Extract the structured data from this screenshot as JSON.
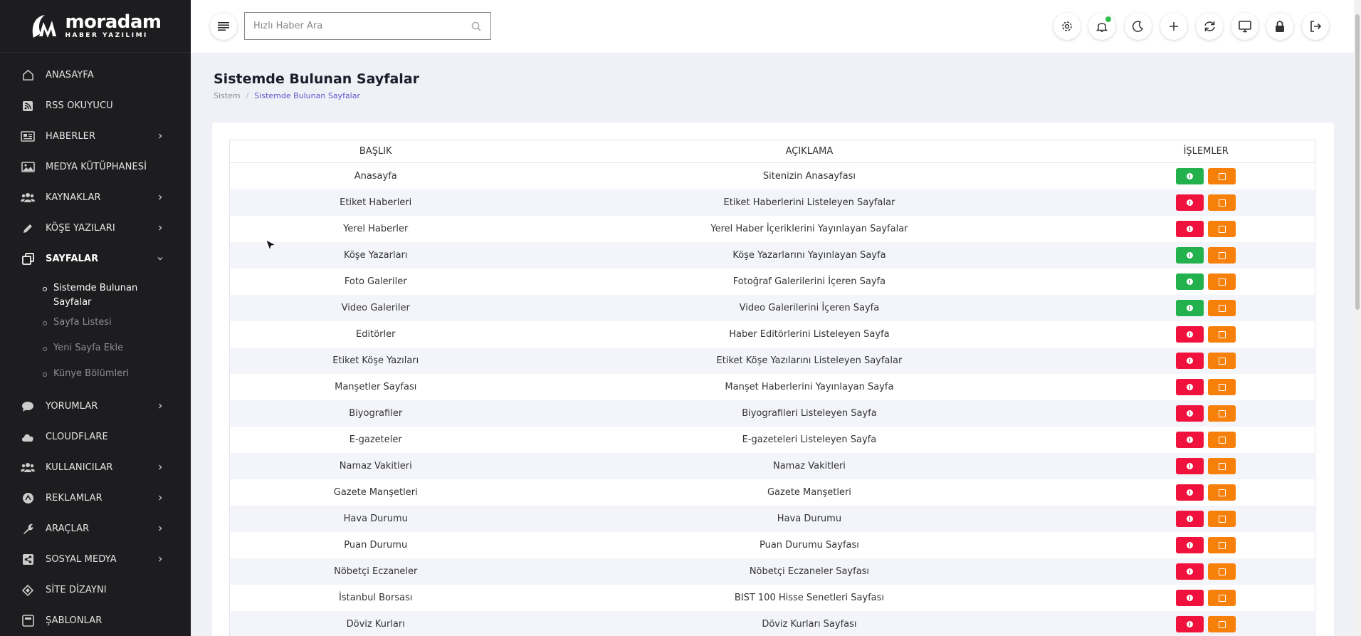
{
  "brand": {
    "name": "moradam",
    "tagline": "HABER YAZILIMI"
  },
  "sidebar": {
    "items": [
      {
        "label": "ANASAYFA",
        "icon": "home-icon",
        "chevron": false
      },
      {
        "label": "RSS OKUYUCU",
        "icon": "rss-icon",
        "chevron": false
      },
      {
        "label": "HABERLER",
        "icon": "newspaper-icon",
        "chevron": true
      },
      {
        "label": "MEDYA KÜTÜPHANESİ",
        "icon": "image-icon",
        "chevron": false
      },
      {
        "label": "KAYNAKLAR",
        "icon": "users-icon",
        "chevron": true
      },
      {
        "label": "KÖŞE YAZILARI",
        "icon": "pencil-icon",
        "chevron": true
      },
      {
        "label": "SAYFALAR",
        "icon": "pages-icon",
        "chevron": "down"
      },
      {
        "label": "YORUMLAR",
        "icon": "comment-icon",
        "chevron": true
      },
      {
        "label": "CLOUDFLARE",
        "icon": "cloud-icon",
        "chevron": false
      },
      {
        "label": "KULLANICILAR",
        "icon": "users-icon",
        "chevron": true
      },
      {
        "label": "REKLAMLAR",
        "icon": "ads-icon",
        "chevron": true
      },
      {
        "label": "ARAÇLAR",
        "icon": "wrench-icon",
        "chevron": true
      },
      {
        "label": "SOSYAL MEDYA",
        "icon": "share-icon",
        "chevron": true
      },
      {
        "label": "SİTE DİZAYNI",
        "icon": "design-icon",
        "chevron": false
      },
      {
        "label": "ŞABLONLAR",
        "icon": "template-icon",
        "chevron": false
      }
    ],
    "submenu": [
      {
        "label": "Sistemde Bulunan Sayfalar",
        "active": true
      },
      {
        "label": "Sayfa Listesi",
        "active": false
      },
      {
        "label": "Yeni Sayfa Ekle",
        "active": false
      },
      {
        "label": "Künye Bölümleri",
        "active": false
      }
    ]
  },
  "topbar": {
    "search_placeholder": "Hızlı Haber Ara",
    "actions": [
      "settings-icon",
      "bell-icon",
      "moon-icon",
      "plus-icon",
      "refresh-icon",
      "monitor-icon",
      "lock-icon",
      "logout-icon"
    ]
  },
  "page": {
    "title": "Sistemde Bulunan Sayfalar",
    "breadcrumb": [
      "Sistem",
      "Sistemde Bulunan Sayfalar"
    ]
  },
  "table": {
    "headers": [
      "BAŞLIK",
      "AÇIKLAMA",
      "İŞLEMLER"
    ],
    "rows": [
      {
        "title": "Anasayfa",
        "desc": "Sitenizin Anasayfası",
        "status": "green"
      },
      {
        "title": "Etiket Haberleri",
        "desc": "Etiket Haberlerini Listeleyen Sayfalar",
        "status": "red"
      },
      {
        "title": "Yerel Haberler",
        "desc": "Yerel Haber İçeriklerini Yayınlayan Sayfalar",
        "status": "red"
      },
      {
        "title": "Köşe Yazarları",
        "desc": "Köşe Yazarlarını Yayınlayan Sayfa",
        "status": "green"
      },
      {
        "title": "Foto Galeriler",
        "desc": "Fotoğraf Galerilerini İçeren Sayfa",
        "status": "green"
      },
      {
        "title": "Video Galeriler",
        "desc": "Video Galerilerini İçeren Sayfa",
        "status": "green"
      },
      {
        "title": "Editörler",
        "desc": "Haber Editörlerini Listeleyen Sayfa",
        "status": "red"
      },
      {
        "title": "Etiket Köşe Yazıları",
        "desc": "Etiket Köşe Yazılarını Listeleyen Sayfalar",
        "status": "red"
      },
      {
        "title": "Manşetler Sayfası",
        "desc": "Manşet Haberlerini Yayınlayan Sayfa",
        "status": "red"
      },
      {
        "title": "Biyografiler",
        "desc": "Biyografileri Listeleyen Sayfa",
        "status": "red"
      },
      {
        "title": "E-gazeteler",
        "desc": "E-gazeteleri Listeleyen Sayfa",
        "status": "red"
      },
      {
        "title": "Namaz Vakitleri",
        "desc": "Namaz Vakitleri",
        "status": "red"
      },
      {
        "title": "Gazete Manşetleri",
        "desc": "Gazete Manşetleri",
        "status": "red"
      },
      {
        "title": "Hava Durumu",
        "desc": "Hava Durumu",
        "status": "red"
      },
      {
        "title": "Puan Durumu",
        "desc": "Puan Durumu Sayfası",
        "status": "red"
      },
      {
        "title": "Nöbetçi Eczaneler",
        "desc": "Nöbetçi Eczaneler Sayfası",
        "status": "red"
      },
      {
        "title": "İstanbul Borsası",
        "desc": "BIST 100 Hisse Senetleri Sayfası",
        "status": "red"
      },
      {
        "title": "Döviz Kurları",
        "desc": "Döviz Kurları Sayfası",
        "status": "red"
      }
    ]
  },
  "colors": {
    "sidebar_bg": "#1d1d1f",
    "green": "#22b14c",
    "red": "#f0123c",
    "orange": "#f7800a",
    "accent": "#5a55c8"
  }
}
